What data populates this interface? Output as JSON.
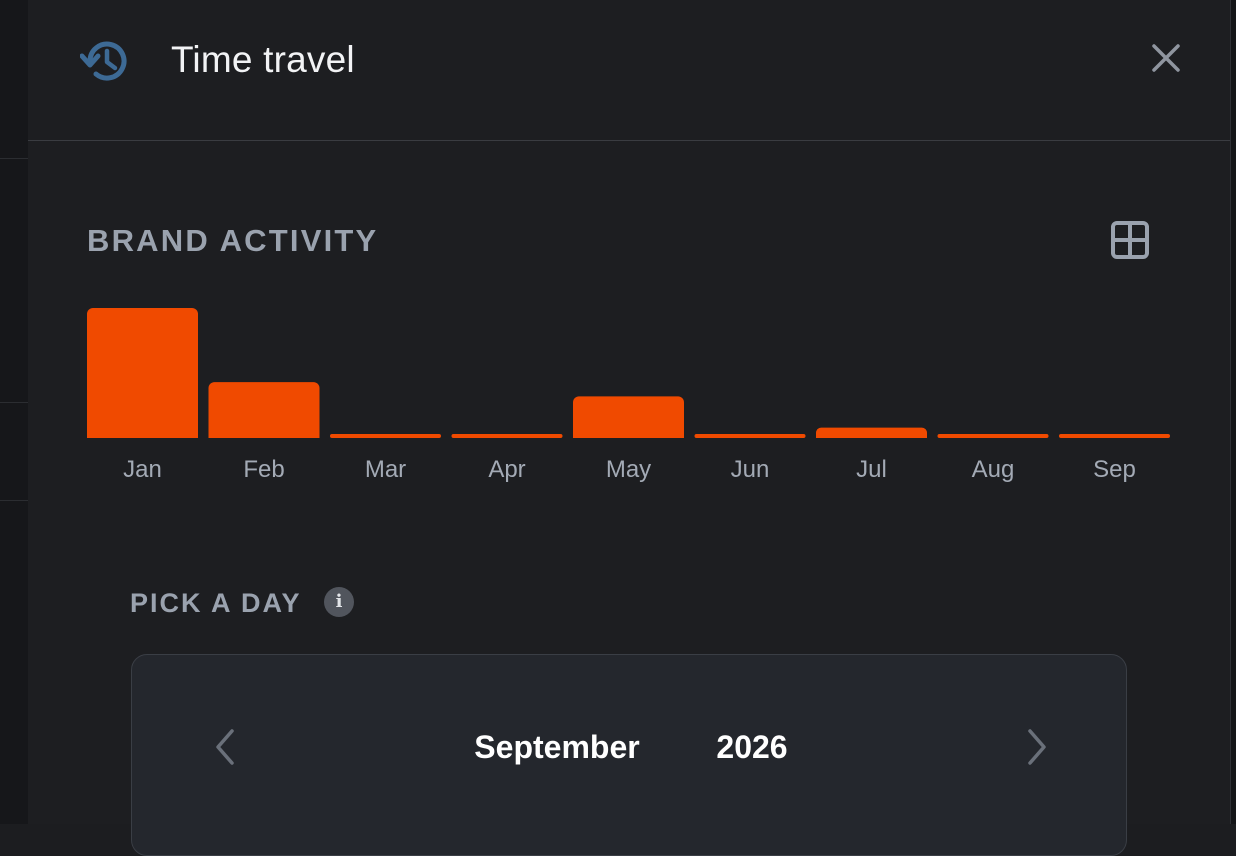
{
  "header": {
    "title": "Time travel",
    "icon": "history-icon",
    "close_icon": "close-icon"
  },
  "activity": {
    "title": "BRAND ACTIVITY",
    "table_icon": "table-view-icon",
    "accent_color": "#f04a00"
  },
  "chart_data": {
    "type": "bar",
    "categories": [
      "Jan",
      "Feb",
      "Mar",
      "Apr",
      "May",
      "Jun",
      "Jul",
      "Aug",
      "Sep"
    ],
    "values": [
      100,
      43,
      3,
      3,
      32,
      3,
      8,
      3,
      3
    ],
    "ylim": [
      0,
      100
    ],
    "grid": false,
    "legend": "none",
    "xlabel": "",
    "ylabel": ""
  },
  "day_picker": {
    "label": "PICK A DAY",
    "info_icon": "info-icon",
    "info_glyph": "i",
    "month": "September",
    "year": "2026",
    "prev_icon": "chevron-left-icon",
    "next_icon": "chevron-right-icon"
  }
}
